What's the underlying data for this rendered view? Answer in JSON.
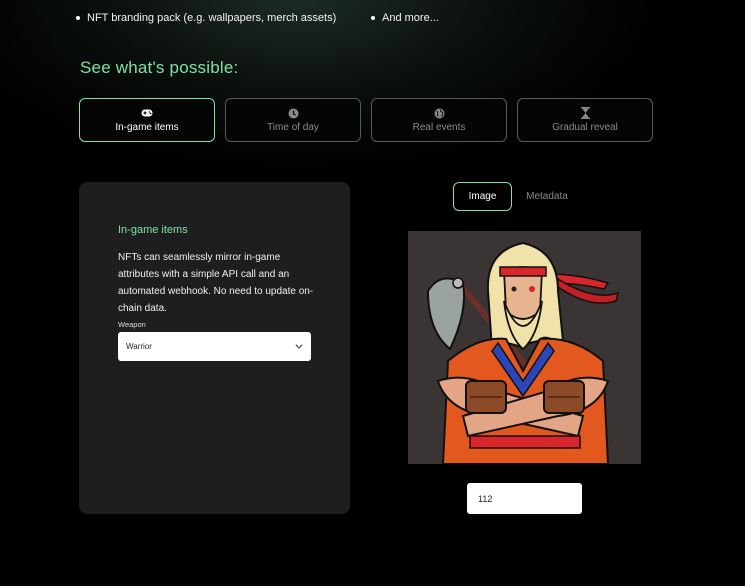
{
  "top_bullets": [
    "NFT branding pack (e.g. wallpapers, merch assets)",
    "And more..."
  ],
  "section_title": "See what's possible:",
  "tabs": [
    {
      "label": "In-game items",
      "icon": "gamepad-icon",
      "active": true
    },
    {
      "label": "Time of day",
      "icon": "clock-icon",
      "active": false
    },
    {
      "label": "Real events",
      "icon": "globe-icon",
      "active": false
    },
    {
      "label": "Gradual reveal",
      "icon": "hourglass-icon",
      "active": false
    }
  ],
  "panel": {
    "title": "In-game items",
    "description": "NFTs can seamlessly mirror in-game attributes with a simple API call and an automated webhook. No need to update on-chain data.",
    "field_label": "Weapon",
    "select_value": "Warrior"
  },
  "view_toggle": {
    "image_label": "Image",
    "metadata_label": "Metadata",
    "selected": "Image"
  },
  "token_id_value": "112",
  "colors": {
    "accent": "#7ee2a8",
    "panel_bg": "#1e1e1e",
    "page_bg": "#000000"
  }
}
